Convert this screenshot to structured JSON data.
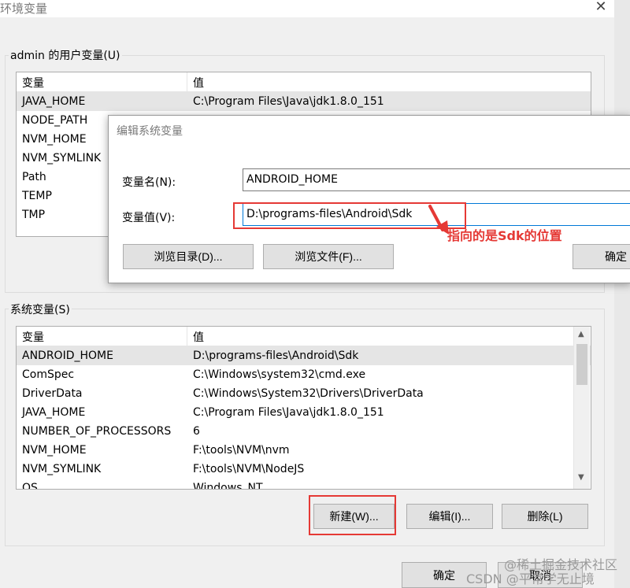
{
  "window": {
    "title": "环境变量",
    "close_glyph": "✕"
  },
  "user_vars": {
    "group_label": "admin 的用户变量(U)",
    "headers": [
      "变量",
      "值"
    ],
    "rows": [
      {
        "name": "JAVA_HOME",
        "value": "C:\\Program Files\\Java\\jdk1.8.0_151"
      },
      {
        "name": "NODE_PATH",
        "value": ""
      },
      {
        "name": "NVM_HOME",
        "value": ""
      },
      {
        "name": "NVM_SYMLINK",
        "value": ""
      },
      {
        "name": "Path",
        "value": ""
      },
      {
        "name": "TEMP",
        "value": ""
      },
      {
        "name": "TMP",
        "value": ""
      }
    ]
  },
  "edit_dialog": {
    "title": "编辑系统变量",
    "name_label": "变量名(N):",
    "name_value": "ANDROID_HOME",
    "value_label": "变量值(V):",
    "value_value": "D:\\programs-files\\Android\\Sdk",
    "browse_dir": "浏览目录(D)...",
    "browse_file": "浏览文件(F)...",
    "ok": "确定"
  },
  "annotation": {
    "note": "指向的是Sdk的位置"
  },
  "system_vars": {
    "group_label": "系统变量(S)",
    "headers": [
      "变量",
      "值"
    ],
    "rows": [
      {
        "name": "ANDROID_HOME",
        "value": "D:\\programs-files\\Android\\Sdk"
      },
      {
        "name": "ComSpec",
        "value": "C:\\Windows\\system32\\cmd.exe"
      },
      {
        "name": "DriverData",
        "value": "C:\\Windows\\System32\\Drivers\\DriverData"
      },
      {
        "name": "JAVA_HOME",
        "value": "C:\\Program Files\\Java\\jdk1.8.0_151"
      },
      {
        "name": "NUMBER_OF_PROCESSORS",
        "value": "6"
      },
      {
        "name": "NVM_HOME",
        "value": "F:\\tools\\NVM\\nvm"
      },
      {
        "name": "NVM_SYMLINK",
        "value": "F:\\tools\\NVM\\NodeJS"
      },
      {
        "name": "OS",
        "value": "Windows_NT"
      }
    ],
    "new_button": "新建(W)...",
    "edit_button": "编辑(I)...",
    "delete_button": "删除(L)"
  },
  "footer": {
    "ok": "确定",
    "cancel": "取消"
  },
  "watermark": {
    "line1": "@稀土掘金技术社区",
    "line2": "CSDN @平常学无止境"
  },
  "colors": {
    "annotation_red": "#e53935",
    "selection": "#e5e5e5"
  }
}
